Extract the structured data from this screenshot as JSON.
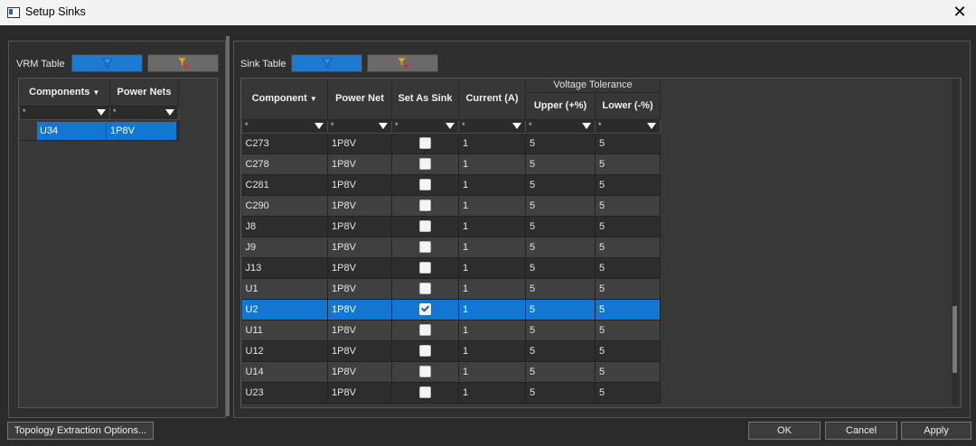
{
  "window": {
    "title": "Setup Sinks",
    "icon": "window-app-icon",
    "close_glyph": "✕"
  },
  "colors": {
    "accent": "#1177d3",
    "filter_button_blue": "#1e7ad1",
    "filter_button_gray": "#6a6a6a",
    "clear_filter_icon": "#e7a43b"
  },
  "vrm": {
    "label": "VRM Table",
    "columns": [
      "Components",
      "Power Nets"
    ],
    "filter_value": "*",
    "rows": [
      {
        "component": "U34",
        "net": "1P8V",
        "selected": true
      }
    ]
  },
  "sink": {
    "label": "Sink Table",
    "group_header": "Voltage Tolerance",
    "columns": [
      "Component",
      "Power Net",
      "Set As Sink",
      "Current (A)",
      "Upper (+%)",
      "Lower (-%)"
    ],
    "filter_value": "*",
    "rows": [
      {
        "component": "C273",
        "net": "1P8V",
        "sink": false,
        "current": "1",
        "upper": "5",
        "lower": "5",
        "selected": false
      },
      {
        "component": "C278",
        "net": "1P8V",
        "sink": false,
        "current": "1",
        "upper": "5",
        "lower": "5",
        "selected": false
      },
      {
        "component": "C281",
        "net": "1P8V",
        "sink": false,
        "current": "1",
        "upper": "5",
        "lower": "5",
        "selected": false
      },
      {
        "component": "C290",
        "net": "1P8V",
        "sink": false,
        "current": "1",
        "upper": "5",
        "lower": "5",
        "selected": false
      },
      {
        "component": "J8",
        "net": "1P8V",
        "sink": false,
        "current": "1",
        "upper": "5",
        "lower": "5",
        "selected": false
      },
      {
        "component": "J9",
        "net": "1P8V",
        "sink": false,
        "current": "1",
        "upper": "5",
        "lower": "5",
        "selected": false
      },
      {
        "component": "J13",
        "net": "1P8V",
        "sink": false,
        "current": "1",
        "upper": "5",
        "lower": "5",
        "selected": false
      },
      {
        "component": "U1",
        "net": "1P8V",
        "sink": false,
        "current": "1",
        "upper": "5",
        "lower": "5",
        "selected": false
      },
      {
        "component": "U2",
        "net": "1P8V",
        "sink": true,
        "current": "1",
        "upper": "5",
        "lower": "5",
        "selected": true
      },
      {
        "component": "U11",
        "net": "1P8V",
        "sink": false,
        "current": "1",
        "upper": "5",
        "lower": "5",
        "selected": false
      },
      {
        "component": "U12",
        "net": "1P8V",
        "sink": false,
        "current": "1",
        "upper": "5",
        "lower": "5",
        "selected": false
      },
      {
        "component": "U14",
        "net": "1P8V",
        "sink": false,
        "current": "1",
        "upper": "5",
        "lower": "5",
        "selected": false
      },
      {
        "component": "U23",
        "net": "1P8V",
        "sink": false,
        "current": "1",
        "upper": "5",
        "lower": "5",
        "selected": false
      }
    ]
  },
  "buttons": {
    "topology": "Topology Extraction Options...",
    "ok": "OK",
    "cancel": "Cancel",
    "apply": "Apply"
  }
}
